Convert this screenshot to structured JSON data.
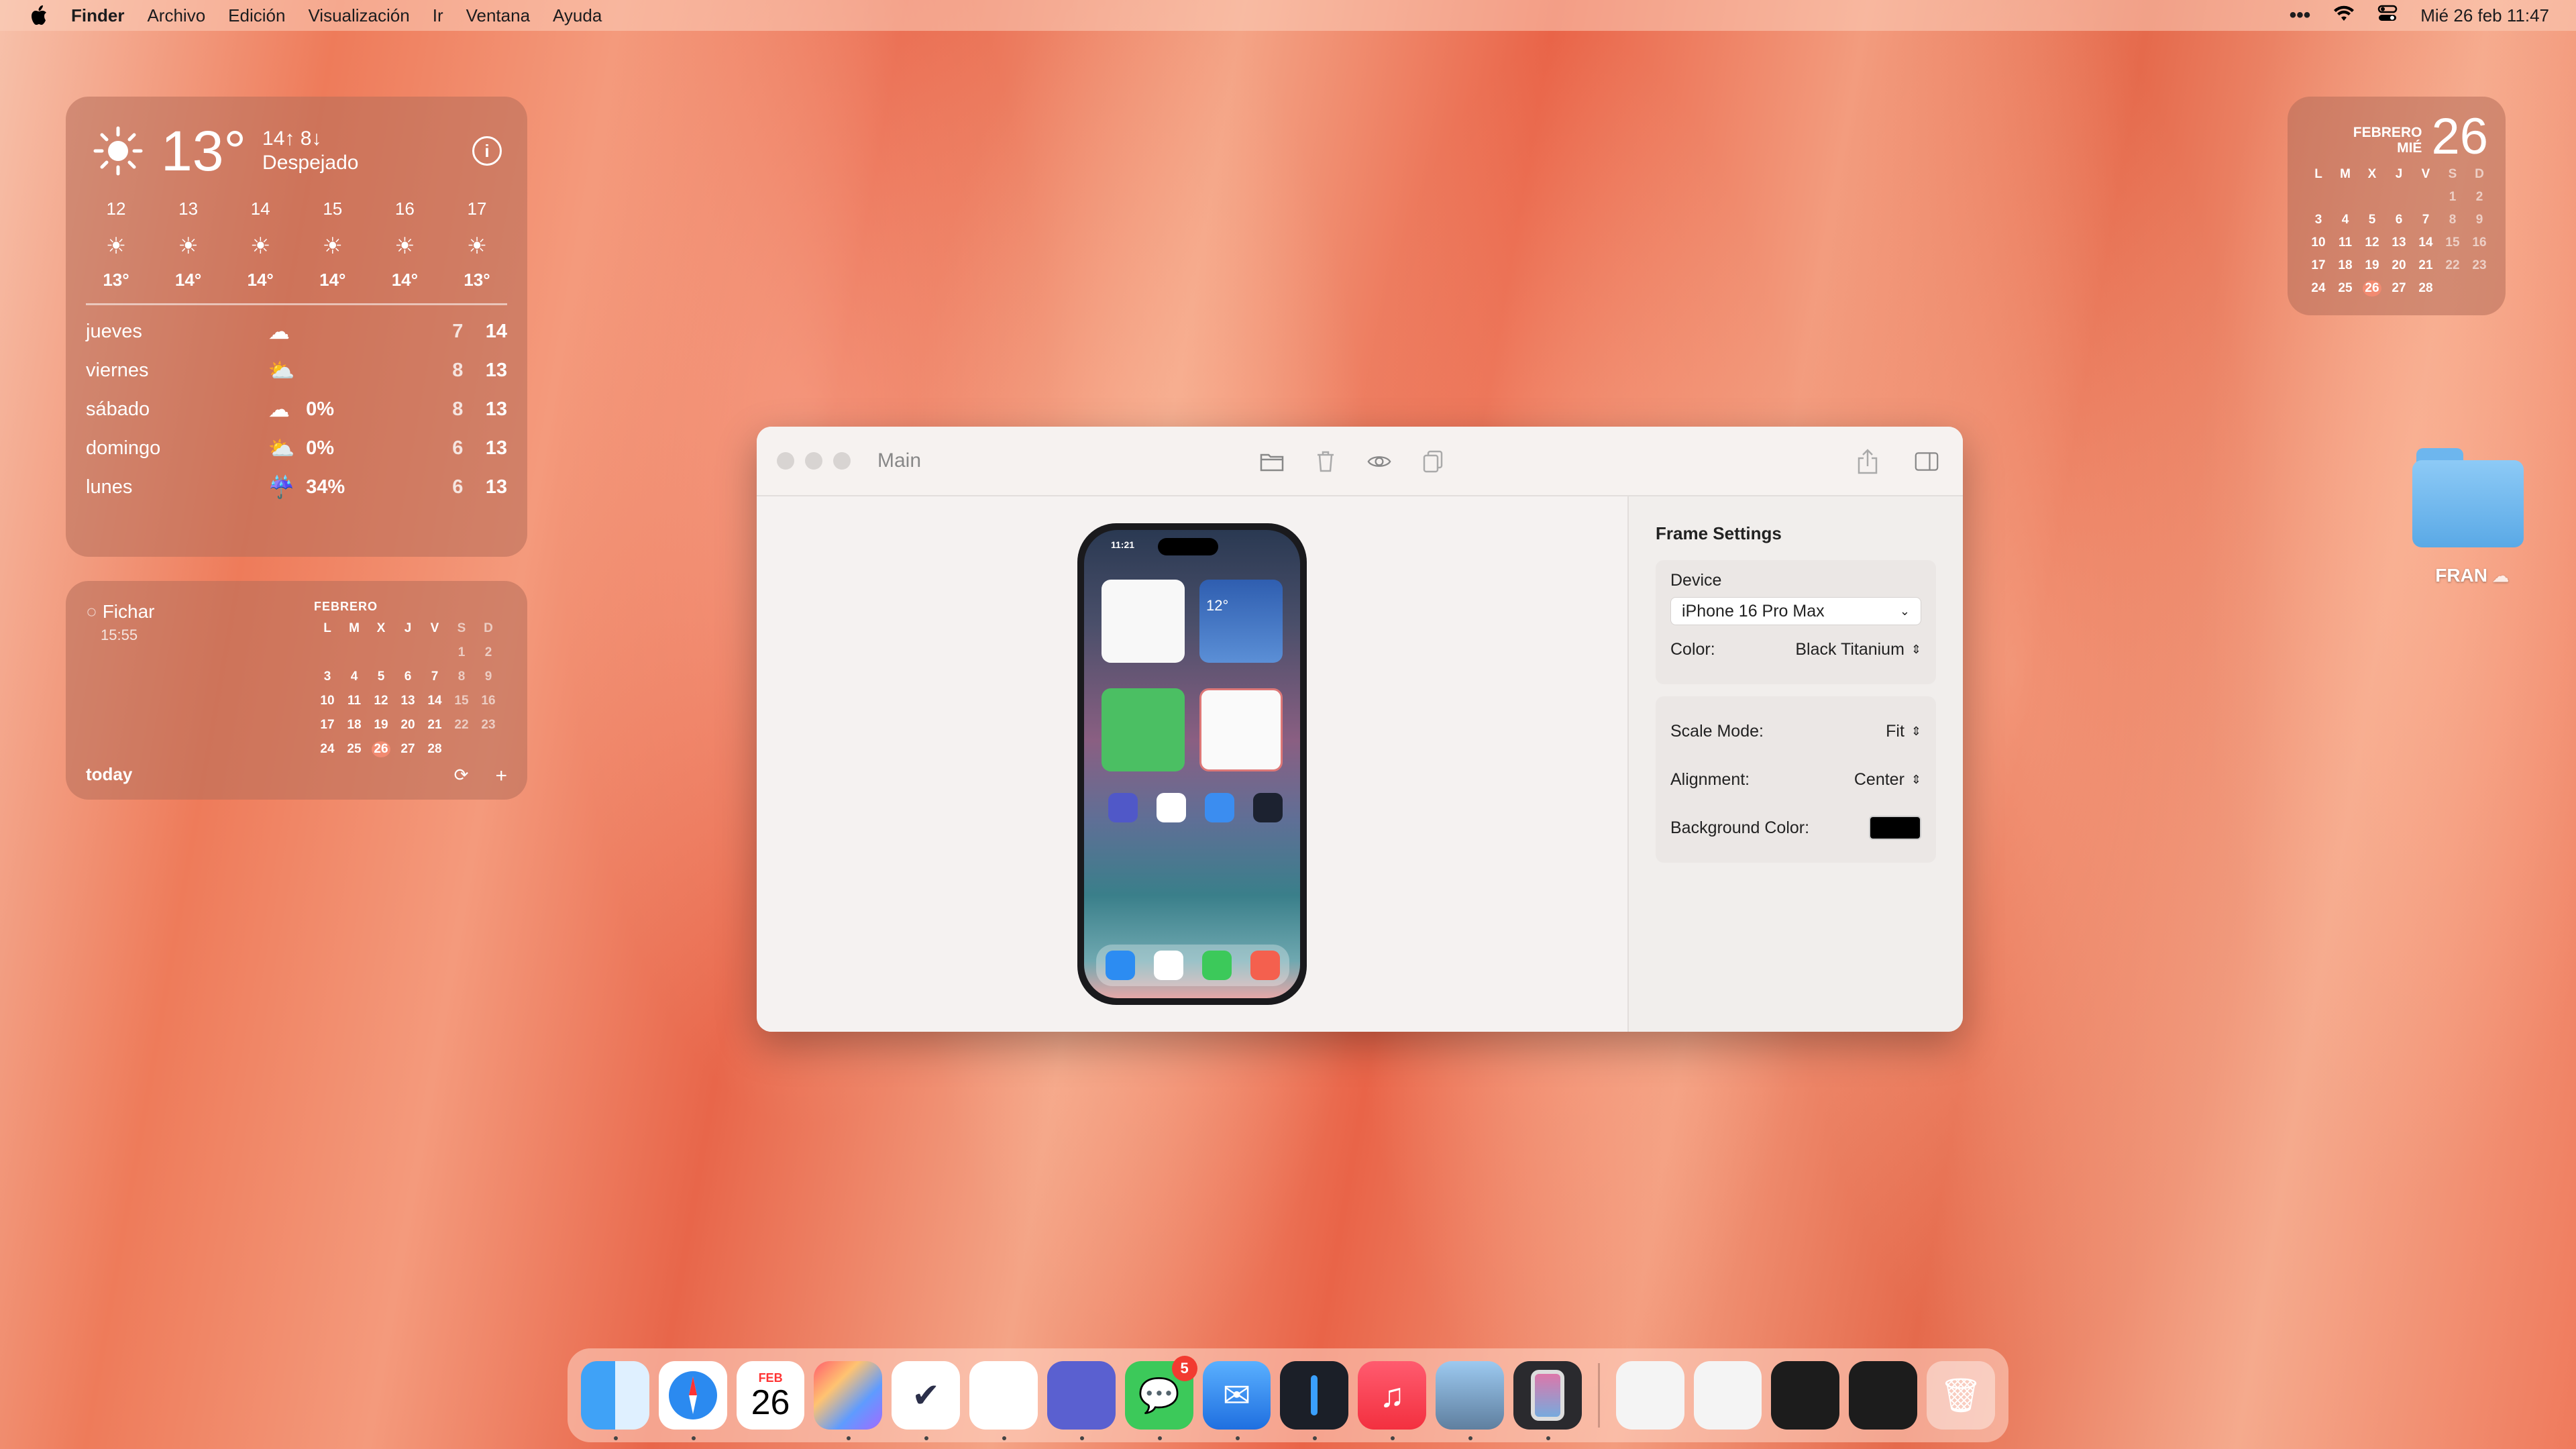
{
  "menubar": {
    "app": "Finder",
    "items": [
      "Archivo",
      "Edición",
      "Visualización",
      "Ir",
      "Ventana",
      "Ayuda"
    ],
    "clock": "Mié 26 feb 11:47"
  },
  "weather": {
    "temp": "13°",
    "hilo": "14↑ 8↓",
    "condition": "Despejado",
    "hours": [
      {
        "h": "12",
        "t": "13°"
      },
      {
        "h": "13",
        "t": "14°"
      },
      {
        "h": "14",
        "t": "14°"
      },
      {
        "h": "15",
        "t": "14°"
      },
      {
        "h": "16",
        "t": "14°"
      },
      {
        "h": "17",
        "t": "13°"
      }
    ],
    "days": [
      {
        "name": "jueves",
        "icon": "cloud-icon",
        "pct": "",
        "lo": "7",
        "hi": "14"
      },
      {
        "name": "viernes",
        "icon": "partly-sunny-icon",
        "pct": "",
        "lo": "8",
        "hi": "13"
      },
      {
        "name": "sábado",
        "icon": "cloud-icon",
        "pct": "0%",
        "lo": "8",
        "hi": "13"
      },
      {
        "name": "domingo",
        "icon": "partly-sunny-icon",
        "pct": "0%",
        "lo": "6",
        "hi": "13"
      },
      {
        "name": "lunes",
        "icon": "rain-icon",
        "pct": "34%",
        "lo": "6",
        "hi": "13"
      }
    ]
  },
  "calwidget": {
    "reminder": "Fichar",
    "time": "15:55",
    "month": "FEBRERO",
    "today": "today"
  },
  "topcal": {
    "month": "FEBRERO",
    "weekday": "MIÉ",
    "day": "26"
  },
  "calendar": {
    "dow": [
      "L",
      "M",
      "X",
      "J",
      "V",
      "S",
      "D"
    ],
    "weeks": [
      [
        "",
        "",
        "",
        "",
        "",
        "1",
        "2"
      ],
      [
        "3",
        "4",
        "5",
        "6",
        "7",
        "8",
        "9"
      ],
      [
        "10",
        "11",
        "12",
        "13",
        "14",
        "15",
        "16"
      ],
      [
        "17",
        "18",
        "19",
        "20",
        "21",
        "22",
        "23"
      ],
      [
        "24",
        "25",
        "26",
        "27",
        "28",
        "",
        ""
      ]
    ]
  },
  "folder": {
    "label": "FRAN"
  },
  "window": {
    "title": "Main",
    "sidebar": {
      "title": "Frame Settings",
      "device_label": "Device",
      "device_value": "iPhone 16 Pro Max",
      "color_label": "Color:",
      "color_value": "Black Titanium",
      "scale_label": "Scale Mode:",
      "scale_value": "Fit",
      "align_label": "Alignment:",
      "align_value": "Center",
      "bg_label": "Background Color:",
      "bg_color": "#000000"
    },
    "phone": {
      "time": "11:21",
      "temp": "12°"
    }
  },
  "dock": {
    "cal_month": "FEB",
    "cal_day": "26",
    "messages_badge": "5"
  }
}
